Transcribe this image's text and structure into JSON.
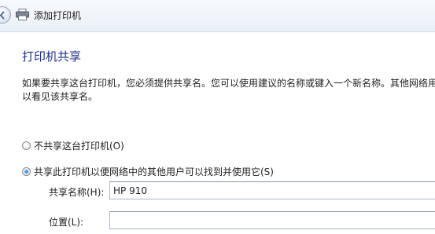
{
  "window": {
    "title": "添加打印机"
  },
  "page": {
    "heading": "打印机共享",
    "description_lines": [
      "如果要共享这台打印机，您必须提供共享名。您可以使用建议的名称或键入一个新名称。其他网络用户可",
      "以看见该共享名。"
    ]
  },
  "options": {
    "no_share": {
      "label": "不共享这台打印机(O)",
      "checked": false
    },
    "share": {
      "label": "共享此打印机以便网络中的其他用户可以找到并使用它(S)",
      "checked": true
    }
  },
  "fields": {
    "share_name": {
      "label": "共享名称(H):",
      "value": "HP 910"
    },
    "location": {
      "label": "位置(L):",
      "value": ""
    }
  },
  "icons": {
    "back": "back-arrow-icon",
    "printer": "printer-icon"
  },
  "colors": {
    "heading": "#1e3287",
    "radio_selected": "#1b5fb5"
  }
}
